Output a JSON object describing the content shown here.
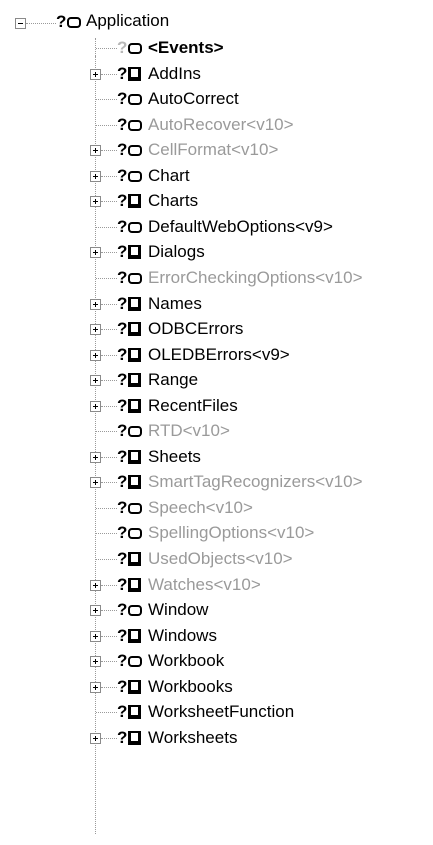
{
  "tree": {
    "root": {
      "label": "Application",
      "help": "?",
      "icon": "object-icon"
    },
    "items": [
      {
        "label": "<Events>",
        "help": "?",
        "icon": "object-icon",
        "expandable": false,
        "dim": false,
        "bold": true,
        "help_dim": true
      },
      {
        "label": "AddIns",
        "help": "?",
        "icon": "collection-icon",
        "expandable": true,
        "dim": false
      },
      {
        "label": "AutoCorrect",
        "help": "?",
        "icon": "object-icon",
        "expandable": false,
        "dim": false
      },
      {
        "label": "AutoRecover<v10>",
        "help": "?",
        "icon": "object-icon",
        "expandable": false,
        "dim": true
      },
      {
        "label": "CellFormat<v10>",
        "help": "?",
        "icon": "object-icon",
        "expandable": true,
        "dim": true
      },
      {
        "label": "Chart",
        "help": "?",
        "icon": "object-icon",
        "expandable": true,
        "dim": false
      },
      {
        "label": "Charts",
        "help": "?",
        "icon": "collection-icon",
        "expandable": true,
        "dim": false
      },
      {
        "label": "DefaultWebOptions<v9>",
        "help": "?",
        "icon": "object-icon",
        "expandable": false,
        "dim": false
      },
      {
        "label": "Dialogs",
        "help": "?",
        "icon": "collection-icon",
        "expandable": true,
        "dim": false
      },
      {
        "label": "ErrorCheckingOptions<v10>",
        "help": "?",
        "icon": "object-icon",
        "expandable": false,
        "dim": true
      },
      {
        "label": "Names",
        "help": "?",
        "icon": "collection-icon",
        "expandable": true,
        "dim": false
      },
      {
        "label": "ODBCErrors",
        "help": "?",
        "icon": "collection-icon",
        "expandable": true,
        "dim": false
      },
      {
        "label": "OLEDBErrors<v9>",
        "help": "?",
        "icon": "collection-icon",
        "expandable": true,
        "dim": false
      },
      {
        "label": "Range",
        "help": "?",
        "icon": "collection-icon",
        "expandable": true,
        "dim": false
      },
      {
        "label": "RecentFiles",
        "help": "?",
        "icon": "collection-icon",
        "expandable": true,
        "dim": false
      },
      {
        "label": "RTD<v10>",
        "help": "?",
        "icon": "object-icon",
        "expandable": false,
        "dim": true
      },
      {
        "label": "Sheets",
        "help": "?",
        "icon": "collection-icon",
        "expandable": true,
        "dim": false
      },
      {
        "label": "SmartTagRecognizers<v10>",
        "help": "?",
        "icon": "collection-icon",
        "expandable": true,
        "dim": true
      },
      {
        "label": "Speech<v10>",
        "help": "?",
        "icon": "object-icon",
        "expandable": false,
        "dim": true
      },
      {
        "label": "SpellingOptions<v10>",
        "help": "?",
        "icon": "object-icon",
        "expandable": false,
        "dim": true
      },
      {
        "label": "UsedObjects<v10>",
        "help": "?",
        "icon": "collection-icon",
        "expandable": false,
        "dim": true
      },
      {
        "label": "Watches<v10>",
        "help": "?",
        "icon": "collection-icon",
        "expandable": true,
        "dim": true
      },
      {
        "label": "Window",
        "help": "?",
        "icon": "object-icon",
        "expandable": true,
        "dim": false
      },
      {
        "label": "Windows",
        "help": "?",
        "icon": "collection-icon",
        "expandable": true,
        "dim": false
      },
      {
        "label": "Workbook",
        "help": "?",
        "icon": "object-icon",
        "expandable": true,
        "dim": false
      },
      {
        "label": "Workbooks",
        "help": "?",
        "icon": "collection-icon",
        "expandable": true,
        "dim": false
      },
      {
        "label": "WorksheetFunction",
        "help": "?",
        "icon": "collection-icon",
        "expandable": false,
        "dim": false
      },
      {
        "label": "Worksheets",
        "help": "?",
        "icon": "collection-icon",
        "expandable": true,
        "dim": false
      }
    ]
  }
}
